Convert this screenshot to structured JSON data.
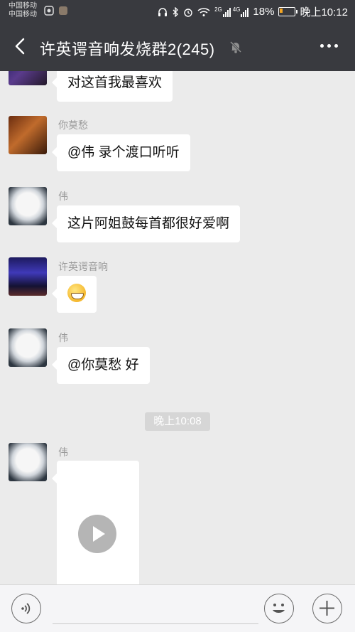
{
  "statusbar": {
    "carrier1": "中国移动",
    "carrier2": "中国移动",
    "net1": "2G",
    "net2": "4G",
    "battery_percent": "18%",
    "battery_level": 0.18,
    "time": "晚上10:12",
    "icons": [
      "headset-icon",
      "bluetooth-icon",
      "alarm-icon",
      "wifi-icon",
      "signal-icon",
      "battery-icon"
    ]
  },
  "header": {
    "title": "许英谔音响发烧群2(245)",
    "back_icon": "back-arrow-icon",
    "mute_icon": "mute-bell-icon",
    "more_icon": "more-dots-icon"
  },
  "messages": [
    {
      "sender": "",
      "text": "对这首我最喜欢"
    },
    {
      "sender": "你莫愁",
      "text": "@伟  录个渡口听听"
    },
    {
      "sender": "伟",
      "text": "这片阿姐鼓每首都很好爱啊"
    },
    {
      "sender": "许英谔音响",
      "emoji": "grin-emoji"
    },
    {
      "sender": "伟",
      "text": "@你莫愁  好"
    },
    {
      "sender": "伟",
      "type": "video"
    }
  ],
  "time_separator": "晚上10:08",
  "input": {
    "placeholder": "",
    "voice_icon": "voice-icon",
    "emoji_icon": "emoji-icon",
    "plus_icon": "plus-icon"
  }
}
